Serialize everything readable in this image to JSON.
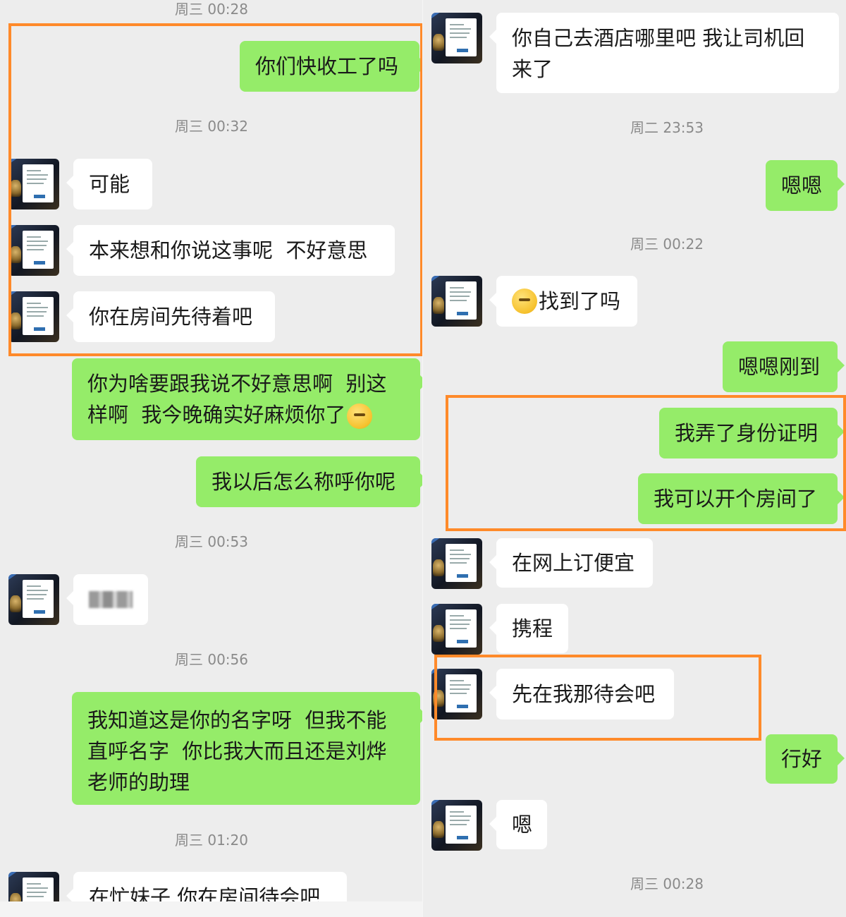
{
  "left": {
    "timestamps": [
      "周三 00:28",
      "周三 00:32",
      "周三 00:53",
      "周三 00:56",
      "周三 01:20"
    ],
    "messages": [
      "你们快收工了吗",
      "可能",
      "本来想和你说这事呢  不好意思",
      "你在房间先待着吧",
      "你为啥要跟我说不好意思啊  别这样啊  我今晚确实好麻烦你了",
      "我以后怎么称呼你呢",
      "",
      "我知道这是你的名字呀  但我不能直呼名字  你比我大而且还是刘烨老师的助理",
      "在忙妹子 你在房间待会吧"
    ]
  },
  "right": {
    "timestamps": [
      "周二 23:53",
      "周三 00:22",
      "周三 00:28"
    ],
    "messages": [
      "你自己去酒店哪里吧 我让司机回来了",
      "嗯嗯",
      "找到了吗",
      "嗯嗯刚到",
      "我弄了身份证明",
      "我可以开个房间了",
      "在网上订便宜",
      "携程",
      "先在我那待会吧",
      "行好",
      "嗯"
    ]
  },
  "icons": {
    "avatar": "contact-avatar-icon",
    "emoji_sad": "sad-face-emoji-icon",
    "emoji_confused": "confused-face-emoji-icon"
  },
  "colors": {
    "background": "#ededed",
    "outgoing_bubble": "#95ec69",
    "incoming_bubble": "#ffffff",
    "highlight_box": "#ff8a2a"
  }
}
